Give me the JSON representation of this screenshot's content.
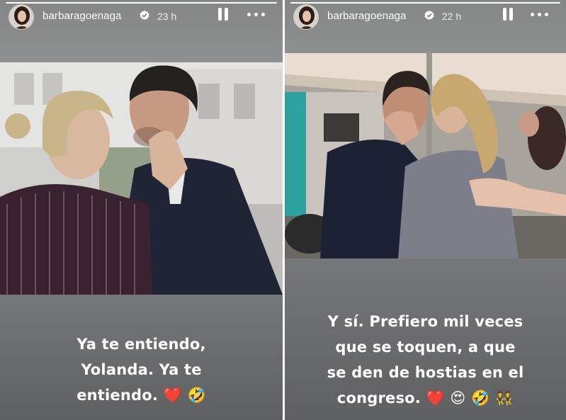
{
  "stories": [
    {
      "username": "barbaragoenaga",
      "time": "23 h",
      "progress": 1.0,
      "caption_lines": [
        "Ya te entiendo,",
        "Yolanda. Ya te",
        "entiendo."
      ],
      "caption_emojis": [
        "❤️",
        "🤣"
      ],
      "icons": [
        "avatar",
        "verified-badge-icon",
        "pause-icon",
        "more-options-icon"
      ]
    },
    {
      "username": "barbaragoenaga",
      "time": "22 h",
      "progress": 1.0,
      "caption_lines": [
        "Y sí. Prefiero mil veces",
        "que se toquen, a que",
        "se den de hostias en el",
        "congreso."
      ],
      "caption_emojis": [
        "❤️",
        "😍",
        "🤣",
        "👯"
      ],
      "icons": [
        "avatar",
        "verified-badge-icon",
        "pause-icon",
        "more-options-icon"
      ]
    }
  ],
  "colors": {
    "story_bg": "#8a8b8c",
    "caption_bg": "#6b6c6d",
    "text": "#ffffff",
    "heart": "#e0202d"
  }
}
